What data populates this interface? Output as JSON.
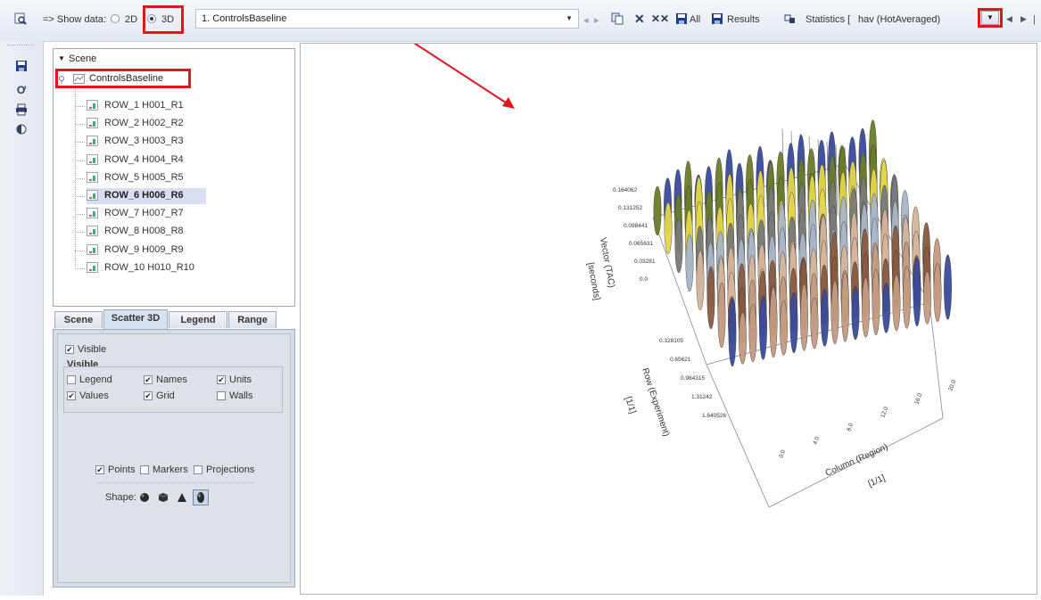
{
  "toolbar": {
    "show_data_label": "=> Show data:",
    "option_2d": "2D",
    "option_3d": "3D",
    "dataset_value": "1. ControlsBaseline",
    "all_label": "All",
    "results_label": "Results",
    "statistics_label": "Statistics [",
    "statistics_value": "hav (HotAveraged)"
  },
  "tree": {
    "root": "Scene",
    "dataset": "ControlsBaseline",
    "rows": [
      {
        "label": "ROW_1 H001_R1"
      },
      {
        "label": "ROW_2 H002_R2"
      },
      {
        "label": "ROW_3 H003_R3"
      },
      {
        "label": "ROW_4 H004_R4"
      },
      {
        "label": "ROW_5 H005_R5"
      },
      {
        "label": "ROW_6 H006_R6"
      },
      {
        "label": "ROW_7 H007_R7"
      },
      {
        "label": "ROW_8 H008_R8"
      },
      {
        "label": "ROW_9 H009_R9"
      },
      {
        "label": "ROW_10 H010_R10"
      }
    ],
    "selected_index": 5
  },
  "tabs": [
    {
      "label": "Scene",
      "active": false
    },
    {
      "label": "Scatter 3D",
      "active": true
    },
    {
      "label": "Legend",
      "active": false
    },
    {
      "label": "Range",
      "active": false
    }
  ],
  "scatter_panel": {
    "visible_checkbox": {
      "label": "Visible",
      "checked": true
    },
    "visible_group_title": "Visible",
    "legend": {
      "label": "Legend",
      "checked": false
    },
    "names": {
      "label": "Names",
      "checked": true
    },
    "units": {
      "label": "Units",
      "checked": true
    },
    "values": {
      "label": "Values",
      "checked": true
    },
    "grid": {
      "label": "Grid",
      "checked": true
    },
    "walls": {
      "label": "Walls",
      "checked": false
    },
    "points": {
      "label": "Points",
      "checked": true
    },
    "markers": {
      "label": "Markers",
      "checked": false
    },
    "projections": {
      "label": "Projections",
      "checked": false
    },
    "shape_label": "Shape:"
  },
  "plot": {
    "z_axis_title": "Vector (TAC)",
    "z_axis_unit": "[seconds]",
    "z_ticks": [
      "0.164062",
      "0.131252",
      "0.098441",
      "0.065631",
      "0.03281",
      "0.0"
    ],
    "row_axis_title": "Row (Experiment)",
    "row_axis_unit": "[1/1]",
    "row_ticks": [
      "0.328105",
      "0.65621",
      "0.984315",
      "1.31242",
      "1.640526"
    ],
    "col_axis_title": "Column (Region)",
    "col_axis_unit": "[1/1]",
    "col_ticks": [
      "0.0",
      "4.0",
      "8.0",
      "12.0",
      "16.0",
      "20.0"
    ],
    "series_colors": [
      "#3a4a9a",
      "#6b7d2a",
      "#e3d64a",
      "#7a7a78",
      "#a8b6c8",
      "#d6b59a",
      "#8a5a40",
      "#c49a80"
    ]
  },
  "icons": {
    "view": "magnifier-icon",
    "save": "floppy-icon",
    "all": "floppy-icon",
    "results": "floppy-icon",
    "print": "printer-icon",
    "contrast": "contrast-icon"
  }
}
